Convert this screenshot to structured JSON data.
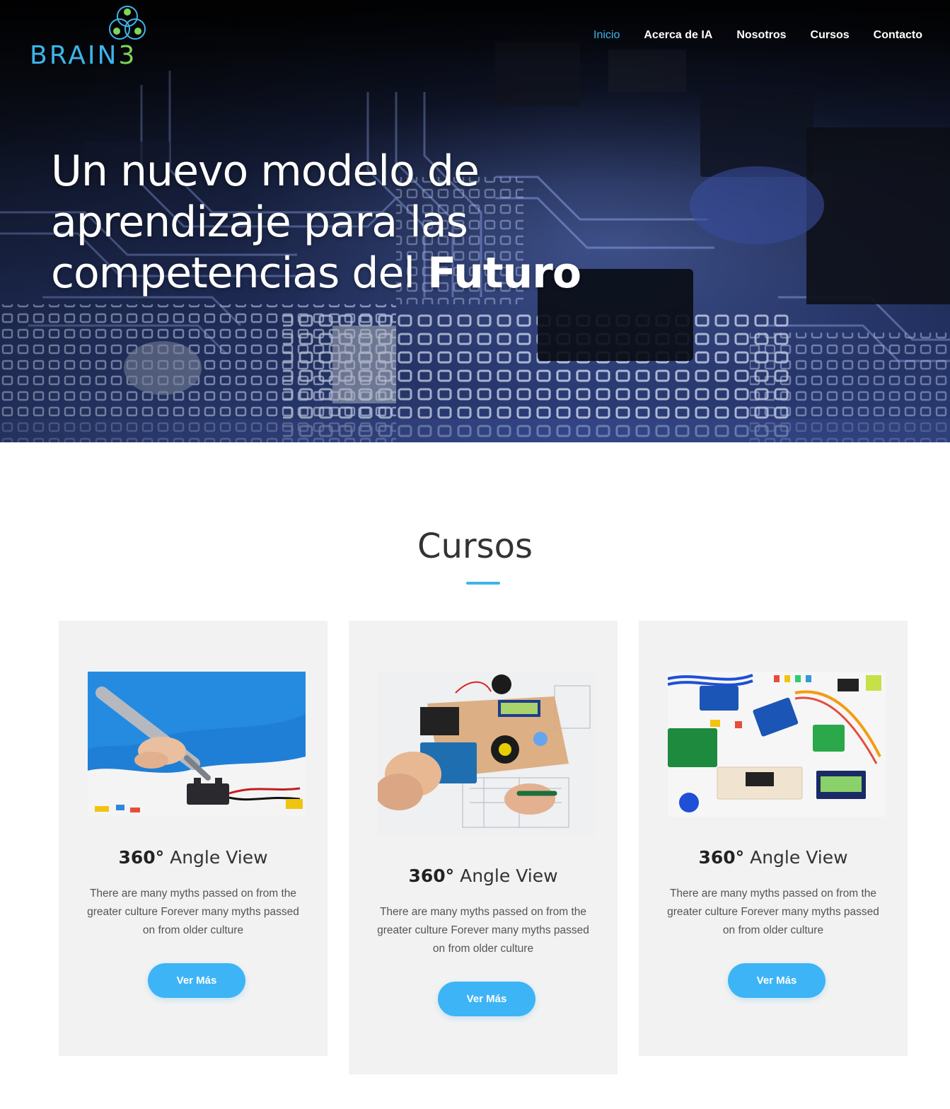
{
  "header": {
    "logo": {
      "text": "BRAIN",
      "digit": "3",
      "icon": "three-circles-logo-icon"
    },
    "nav": [
      {
        "label": "Inicio",
        "active": true
      },
      {
        "label": "Acerca de IA",
        "active": false
      },
      {
        "label": "Nosotros",
        "active": false
      },
      {
        "label": "Cursos",
        "active": false
      },
      {
        "label": "Contacto",
        "active": false
      }
    ]
  },
  "hero": {
    "line1": "Un nuevo modelo de",
    "line2": "aprendizaje para las",
    "line3_prefix": "competencias del ",
    "line3_strong": "Futuro",
    "background": "circuit-board-photo"
  },
  "courses": {
    "title": "Cursos",
    "cards": [
      {
        "heading_bold": "360°",
        "heading_rest": " Angle View",
        "text": "There are many myths passed on from the greater culture Forever many myths passed on from older culture",
        "button": "Ver Más",
        "image": "soldering-battery-holder-photo"
      },
      {
        "heading_bold": "360°",
        "heading_rest": " Angle View",
        "text": "There are many myths passed on from the greater culture Forever many myths passed on from older culture",
        "button": "Ver Más",
        "image": "arduino-robot-car-photo"
      },
      {
        "heading_bold": "360°",
        "heading_rest": " Angle View",
        "text": "There are many myths passed on from the greater culture Forever many myths passed on from older culture",
        "button": "Ver Más",
        "image": "electronics-components-kit-photo"
      }
    ]
  },
  "colors": {
    "accent": "#3db4ea",
    "button": "#3db4f5",
    "card_bg": "#f2f2f2",
    "logo_green": "#7fd65a"
  }
}
